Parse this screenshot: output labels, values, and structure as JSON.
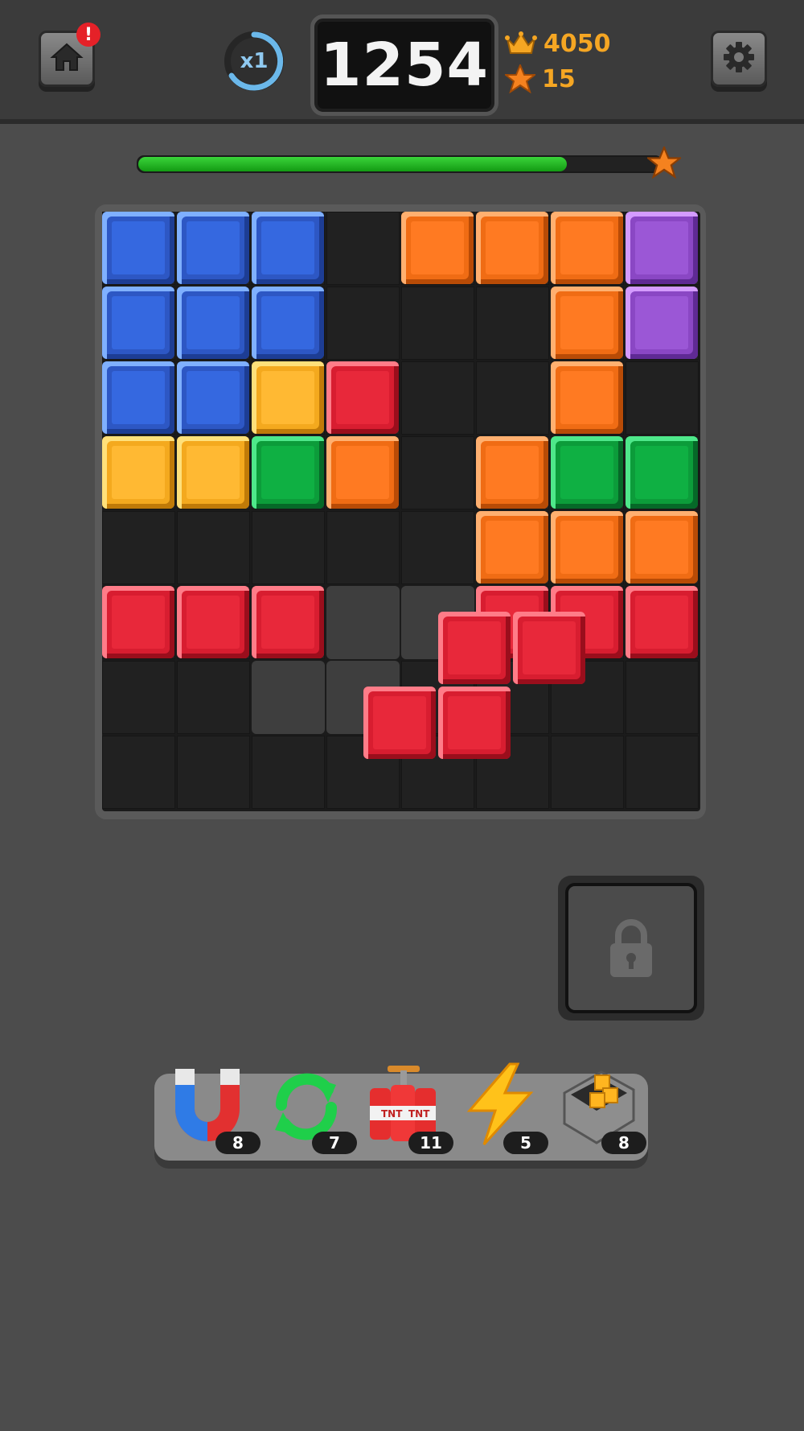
{
  "header": {
    "home_badge": "!",
    "multiplier": "x1",
    "score": "1254",
    "best_score": "4050",
    "stars": "15"
  },
  "progress": {
    "value": 0.82
  },
  "board": {
    "cols": 8,
    "rows": 8,
    "colors": {
      "blue": {
        "face": "#3568e0",
        "side": "#2d57c4",
        "hi": "#7fb0ff",
        "lo": "#1d3d94"
      },
      "orange": {
        "face": "#ff7a22",
        "side": "#f06c14",
        "hi": "#ffb070",
        "lo": "#b84b06"
      },
      "purple": {
        "face": "#9b57d6",
        "side": "#8a47c4",
        "hi": "#d49bff",
        "lo": "#5f2a94"
      },
      "yellow": {
        "face": "#ffb933",
        "side": "#f4a91e",
        "hi": "#ffe07a",
        "lo": "#c07a08"
      },
      "red": {
        "face": "#e8283a",
        "side": "#d81d30",
        "hi": "#ff7c88",
        "lo": "#9a0e1c"
      },
      "green": {
        "face": "#0fb043",
        "side": "#0c9c3a",
        "hi": "#4ee88a",
        "lo": "#066828"
      }
    },
    "grid": [
      [
        "blue",
        "blue",
        "blue",
        "",
        "orange",
        "orange",
        "orange",
        "purple"
      ],
      [
        "blue",
        "blue",
        "blue",
        "",
        "",
        "",
        "orange",
        "purple"
      ],
      [
        "blue",
        "blue",
        "yellow",
        "red",
        "",
        "",
        "orange",
        ""
      ],
      [
        "yellow",
        "yellow",
        "green",
        "orange",
        "",
        "orange",
        "green",
        "green"
      ],
      [
        "",
        "",
        "",
        "",
        "",
        "orange",
        "orange",
        "orange"
      ],
      [
        "red",
        "red",
        "red",
        "ghost",
        "ghost",
        "red",
        "red",
        "red"
      ],
      [
        "",
        "",
        "ghost",
        "ghost",
        "",
        "",
        "",
        ""
      ],
      [
        "",
        "",
        "",
        "",
        "",
        "",
        "",
        ""
      ]
    ],
    "dragging_piece": {
      "color": "red",
      "cells": [
        [
          1,
          0
        ],
        [
          2,
          0
        ],
        [
          0,
          1
        ],
        [
          1,
          1
        ]
      ]
    }
  },
  "powerups": [
    {
      "name": "magnet",
      "count": "8"
    },
    {
      "name": "refresh",
      "count": "7"
    },
    {
      "name": "tnt",
      "count": "11"
    },
    {
      "name": "lightning",
      "count": "5"
    },
    {
      "name": "block-box",
      "count": "8"
    }
  ]
}
